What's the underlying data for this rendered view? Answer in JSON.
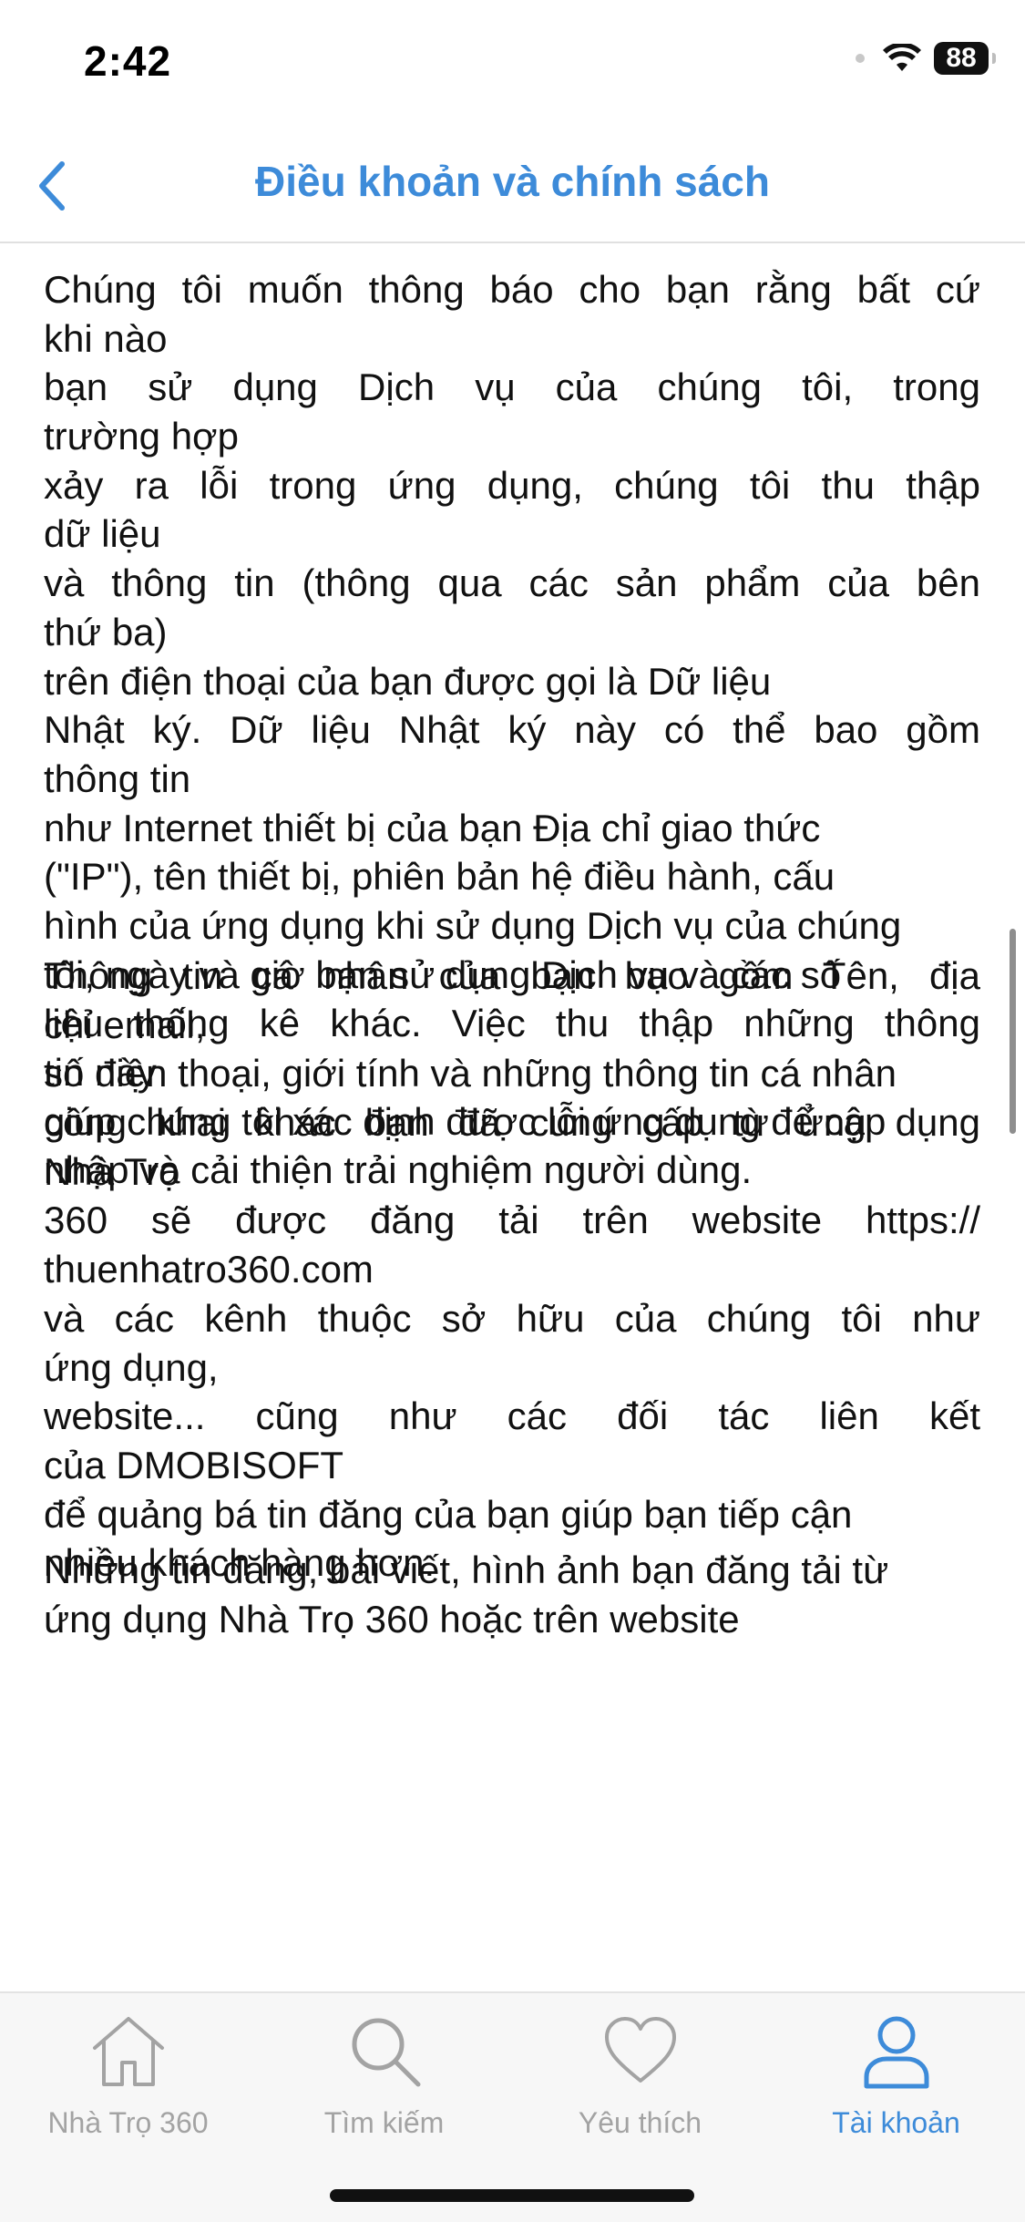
{
  "status_bar": {
    "time": "2:42",
    "battery": "88"
  },
  "nav": {
    "title": "Điều khoản và chính sách"
  },
  "content": {
    "paragraphs": [
      [
        {
          "t": "Chúng tôi muốn thông báo cho bạn rằng bất cứ",
          "j": true
        },
        {
          "t": "khi nào",
          "j": false
        },
        {
          "t": "bạn sử dụng Dịch vụ của chúng tôi, trong",
          "j": true
        },
        {
          "t": "trường hợp",
          "j": false
        },
        {
          "t": "xảy ra lỗi trong ứng dụng, chúng tôi thu thập",
          "j": true
        },
        {
          "t": "dữ liệu",
          "j": false
        },
        {
          "t": "và thông tin (thông qua các sản phẩm của bên",
          "j": true
        },
        {
          "t": "thứ ba)",
          "j": false
        },
        {
          "t": "trên điện thoại của bạn được gọi là Dữ liệu",
          "j": false
        },
        {
          "t": "Nhật ký. Dữ liệu Nhật ký này có thể bao gồm",
          "j": true
        },
        {
          "t": "thông tin",
          "j": false
        },
        {
          "t": "như Internet thiết bị của bạn Địa chỉ giao thức",
          "j": false
        },
        {
          "t": "(\"IP\"), tên thiết bị, phiên bản hệ điều hành, cấu",
          "j": false
        },
        {
          "t": "hình của ứng dụng khi sử dụng Dịch vụ của chúng",
          "j": false
        },
        {
          "t": "tôi, ngày và giờ bạn sử dụng Dịch vụ và các số",
          "j": false
        },
        {
          "t": "liệu thống kê khác. Việc thu thập những thông",
          "j": true
        },
        {
          "t": "tin này",
          "j": false
        },
        {
          "t": "giúp chúng tôi xác định được lỗi ứng dụng để cập",
          "j": false
        },
        {
          "t": "nhập và cải thiện trải nghiệm người dùng.",
          "j": false
        }
      ],
      [
        {
          "t": "Thông tin cá nhân của bạn bao gồm Tên, địa",
          "j": true
        },
        {
          "t": "chỉ email,",
          "j": false
        },
        {
          "t": "số điện thoại, giới tính và những thông tin cá nhân",
          "j": false
        },
        {
          "t": "công khai khác bạn đã cung cấp từ ứng dụng",
          "j": true
        },
        {
          "t": "Nhà Trọ",
          "j": false
        },
        {
          "t": "360 sẽ được đăng tải trên website https://",
          "j": true
        },
        {
          "t": "thuenhatro360.com",
          "j": false
        },
        {
          "t": "và các kênh thuộc sở hữu của chúng tôi như",
          "j": true
        },
        {
          "t": "ứng dụng,",
          "j": false
        },
        {
          "t": "website... cũng như các đối tác liên kết",
          "j": true
        },
        {
          "t": "của DMOBISOFT",
          "j": false
        },
        {
          "t": "để quảng bá tin đăng của bạn giúp bạn tiếp cận",
          "j": false
        },
        {
          "t": "nhiều khách hàng hơn.",
          "j": false
        }
      ],
      [
        {
          "t": "Những tin đăng, bài viết, hình ảnh bạn đăng tải từ",
          "j": false
        },
        {
          "t": "ứng dụng Nhà Trọ 360 hoặc trên website",
          "j": false
        }
      ]
    ]
  },
  "tabs": [
    {
      "label": "Nhà Trọ 360",
      "icon": "home-icon",
      "active": false
    },
    {
      "label": "Tìm kiếm",
      "icon": "search-icon",
      "active": false
    },
    {
      "label": "Yêu thích",
      "icon": "heart-icon",
      "active": false
    },
    {
      "label": "Tài khoản",
      "icon": "person-icon",
      "active": true
    }
  ],
  "colors": {
    "accent": "#3d8bd9",
    "inactive": "#a3a3a3"
  }
}
